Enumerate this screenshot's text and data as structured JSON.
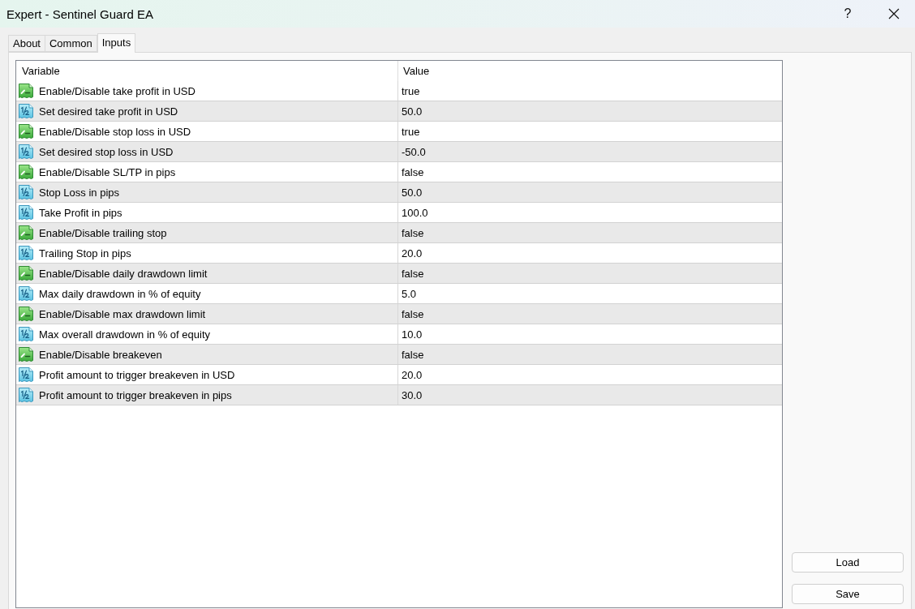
{
  "window": {
    "title": "Expert - Sentinel Guard EA",
    "help_button": "?"
  },
  "tabs": [
    {
      "label": "About",
      "selected": false
    },
    {
      "label": "Common",
      "selected": false
    },
    {
      "label": "Inputs",
      "selected": true
    }
  ],
  "inputs_table": {
    "columns": [
      "Variable",
      "Value"
    ],
    "rows": [
      {
        "kind": "bool",
        "variable": "Enable/Disable take profit in USD",
        "value": "true"
      },
      {
        "kind": "double",
        "variable": "Set desired take profit in USD",
        "value": "50.0"
      },
      {
        "kind": "bool",
        "variable": "Enable/Disable stop loss in USD",
        "value": "true"
      },
      {
        "kind": "double",
        "variable": "Set desired stop loss in USD",
        "value": "-50.0"
      },
      {
        "kind": "bool",
        "variable": "Enable/Disable SL/TP in pips",
        "value": "false"
      },
      {
        "kind": "double",
        "variable": "Stop Loss in pips",
        "value": "50.0"
      },
      {
        "kind": "double",
        "variable": "Take Profit in pips",
        "value": "100.0"
      },
      {
        "kind": "bool",
        "variable": "Enable/Disable trailing stop",
        "value": "false"
      },
      {
        "kind": "double",
        "variable": "Trailing Stop in pips",
        "value": "20.0"
      },
      {
        "kind": "bool",
        "variable": "Enable/Disable daily drawdown limit",
        "value": "false"
      },
      {
        "kind": "double",
        "variable": "Max daily drawdown in % of equity",
        "value": "5.0"
      },
      {
        "kind": "bool",
        "variable": "Enable/Disable max drawdown limit",
        "value": "false"
      },
      {
        "kind": "double",
        "variable": "Max overall drawdown in % of equity",
        "value": "10.0"
      },
      {
        "kind": "bool",
        "variable": "Enable/Disable breakeven",
        "value": "false"
      },
      {
        "kind": "double",
        "variable": "Profit amount to trigger breakeven in USD",
        "value": "20.0"
      },
      {
        "kind": "double",
        "variable": "Profit amount to trigger breakeven in pips",
        "value": "30.0"
      }
    ]
  },
  "buttons": [
    "Load",
    "Save"
  ]
}
